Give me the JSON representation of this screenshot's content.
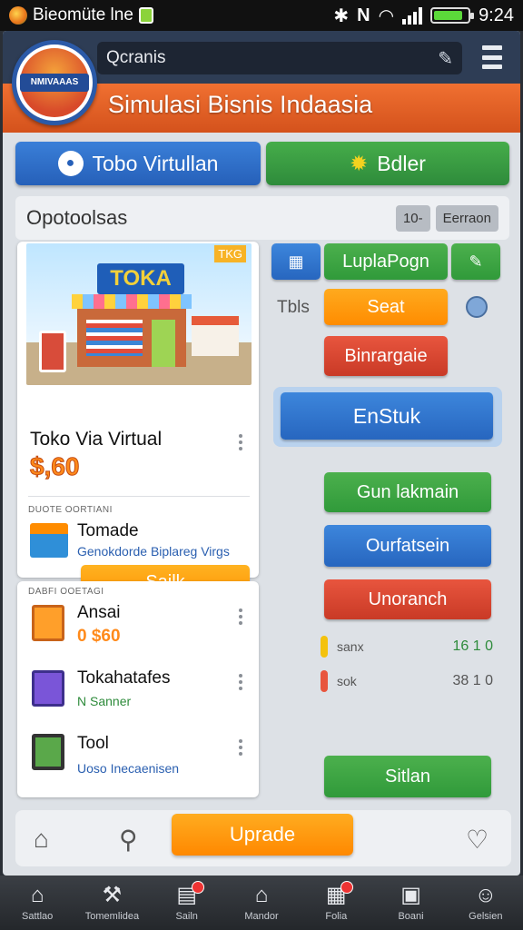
{
  "status_bar": {
    "app_name": "Bieomüte lne",
    "time": "9:24"
  },
  "header": {
    "search_text": "Qcranis",
    "logo_text": "NMIVAAAS",
    "title": "Simulasi Bisnis Indaasia"
  },
  "top_buttons": {
    "left_label": "Tobo Virtullan",
    "right_label": "Bdler"
  },
  "options_panel": {
    "title": "Opotoolsas",
    "chip_count": "10-",
    "chip_label": "Eerraon"
  },
  "product_card": {
    "sign_text": "TOKA",
    "corner_tag": "TKG",
    "name": "Toko Via Virtual",
    "price": "$,60",
    "section_caption": "DUOTE OORTIANI",
    "item_name": "Tomade",
    "item_subtitle": "Genokdorde Biplareg Virgs",
    "button_label": "Sailk"
  },
  "list_card": {
    "caption": "DABFI OOETAGI",
    "items": [
      {
        "name": "Ansai",
        "value": "0 $60"
      },
      {
        "name": "Tokahatafes",
        "value": "N Sanner"
      },
      {
        "name": "Tool",
        "value": "Uoso Inecaenisen"
      }
    ]
  },
  "right_column": {
    "icon_label": "Tbls",
    "lupla_button": "LuplaPogn",
    "seat_button": "Seat",
    "binrargaie_button": "Binrargaie",
    "enstuk_button": "EnStuk",
    "gun_button": "Gun lakmain",
    "ourfatsein_button": "Ourfatsein",
    "unoranch_button": "Unoranch",
    "stats": [
      {
        "label": "sanx",
        "value": "16 1 0",
        "color": "#f4c20d"
      },
      {
        "label": "sok",
        "value": "38 1 0",
        "color": "#e8553e"
      }
    ],
    "sitlan_button": "Sitlan"
  },
  "action_bar": {
    "upgrade_label": "Uprade"
  },
  "nav_bar": {
    "items": [
      {
        "label": "Sattlao",
        "icon": "home-icon"
      },
      {
        "label": "Tomemlidea",
        "icon": "tools-icon"
      },
      {
        "label": "Sailn",
        "icon": "cash-register-icon"
      },
      {
        "label": "Mandor",
        "icon": "store-icon"
      },
      {
        "label": "Folia",
        "icon": "report-icon"
      },
      {
        "label": "Boani",
        "icon": "calculator-icon"
      },
      {
        "label": "Gelsien",
        "icon": "profile-icon"
      }
    ]
  },
  "colors": {
    "header_navy": "#2e3d55",
    "header_orange": "#f07031",
    "primary_blue": "#2766bf",
    "primary_green": "#309a3a",
    "accent_orange": "#ff8c00",
    "danger_red": "#c93a26"
  }
}
